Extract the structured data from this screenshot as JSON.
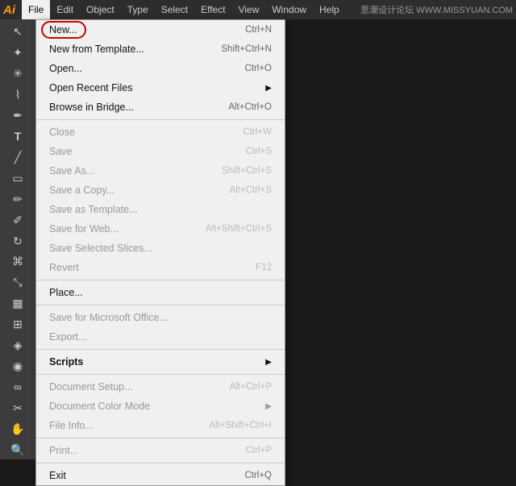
{
  "app": {
    "logo": "Ai",
    "watermark": "思潮设计论坛 WWW.MISSYUAN.COM"
  },
  "menubar": {
    "items": [
      {
        "label": "File",
        "active": true
      },
      {
        "label": "Edit"
      },
      {
        "label": "Object"
      },
      {
        "label": "Type"
      },
      {
        "label": "Select"
      },
      {
        "label": "Effect"
      },
      {
        "label": "View"
      },
      {
        "label": "Window"
      },
      {
        "label": "Help"
      }
    ]
  },
  "file_menu": {
    "items": [
      {
        "label": "New...",
        "shortcut": "Ctrl+N",
        "highlighted": false,
        "new_item": true,
        "separator_after": false
      },
      {
        "label": "New from Template...",
        "shortcut": "Shift+Ctrl+N",
        "separator_after": false
      },
      {
        "label": "Open...",
        "shortcut": "Ctrl+O",
        "separator_after": false
      },
      {
        "label": "Open Recent Files",
        "shortcut": "",
        "arrow": true,
        "separator_after": false
      },
      {
        "label": "Browse in Bridge...",
        "shortcut": "Alt+Ctrl+O",
        "separator_after": true
      },
      {
        "label": "Close",
        "shortcut": "Ctrl+W",
        "separator_after": false
      },
      {
        "label": "Save",
        "shortcut": "Ctrl+S",
        "separator_after": false
      },
      {
        "label": "Save As...",
        "shortcut": "Shift+Ctrl+S",
        "separator_after": false
      },
      {
        "label": "Save a Copy...",
        "shortcut": "Alt+Ctrl+S",
        "separator_after": false
      },
      {
        "label": "Save as Template...",
        "shortcut": "",
        "separator_after": false
      },
      {
        "label": "Save for Web...",
        "shortcut": "Alt+Shift+Ctrl+S",
        "separator_after": false
      },
      {
        "label": "Save Selected Slices...",
        "shortcut": "",
        "separator_after": false
      },
      {
        "label": "Revert",
        "shortcut": "F12",
        "separator_after": true
      },
      {
        "label": "Place...",
        "shortcut": "",
        "separator_after": true
      },
      {
        "label": "Save for Microsoft Office...",
        "shortcut": "",
        "separator_after": false
      },
      {
        "label": "Export...",
        "shortcut": "",
        "separator_after": true
      },
      {
        "label": "Scripts",
        "shortcut": "",
        "arrow": true,
        "separator_after": true
      },
      {
        "label": "Document Setup...",
        "shortcut": "Alt+Ctrl+P",
        "separator_after": false
      },
      {
        "label": "Document Color Mode",
        "shortcut": "",
        "arrow": true,
        "separator_after": false
      },
      {
        "label": "File Info...",
        "shortcut": "Alt+Shift+Ctrl+I",
        "separator_after": true
      },
      {
        "label": "Print...",
        "shortcut": "Ctrl+P",
        "separator_after": true
      },
      {
        "label": "Exit",
        "shortcut": "Ctrl+Q",
        "separator_after": false
      }
    ]
  },
  "toolbar": {
    "tools": [
      {
        "icon": "↖",
        "name": "selection"
      },
      {
        "icon": "✦",
        "name": "direct-selection"
      },
      {
        "icon": "⬡",
        "name": "pen"
      },
      {
        "icon": "T",
        "name": "type"
      },
      {
        "icon": "✏",
        "name": "pencil"
      },
      {
        "icon": "▭",
        "name": "rectangle"
      },
      {
        "icon": "⟲",
        "name": "rotate"
      },
      {
        "icon": "🖊",
        "name": "warp"
      },
      {
        "icon": "◈",
        "name": "free-transform"
      },
      {
        "icon": "◉",
        "name": "symbol"
      },
      {
        "icon": "≋",
        "name": "column-graph"
      },
      {
        "icon": "⬟",
        "name": "mesh"
      },
      {
        "icon": "◈",
        "name": "gradient"
      },
      {
        "icon": "◉",
        "name": "eyedropper"
      },
      {
        "icon": "✋",
        "name": "blend"
      },
      {
        "icon": "✂",
        "name": "scissors"
      },
      {
        "icon": "✋",
        "name": "hand"
      },
      {
        "icon": "□",
        "name": "zoom"
      }
    ]
  }
}
